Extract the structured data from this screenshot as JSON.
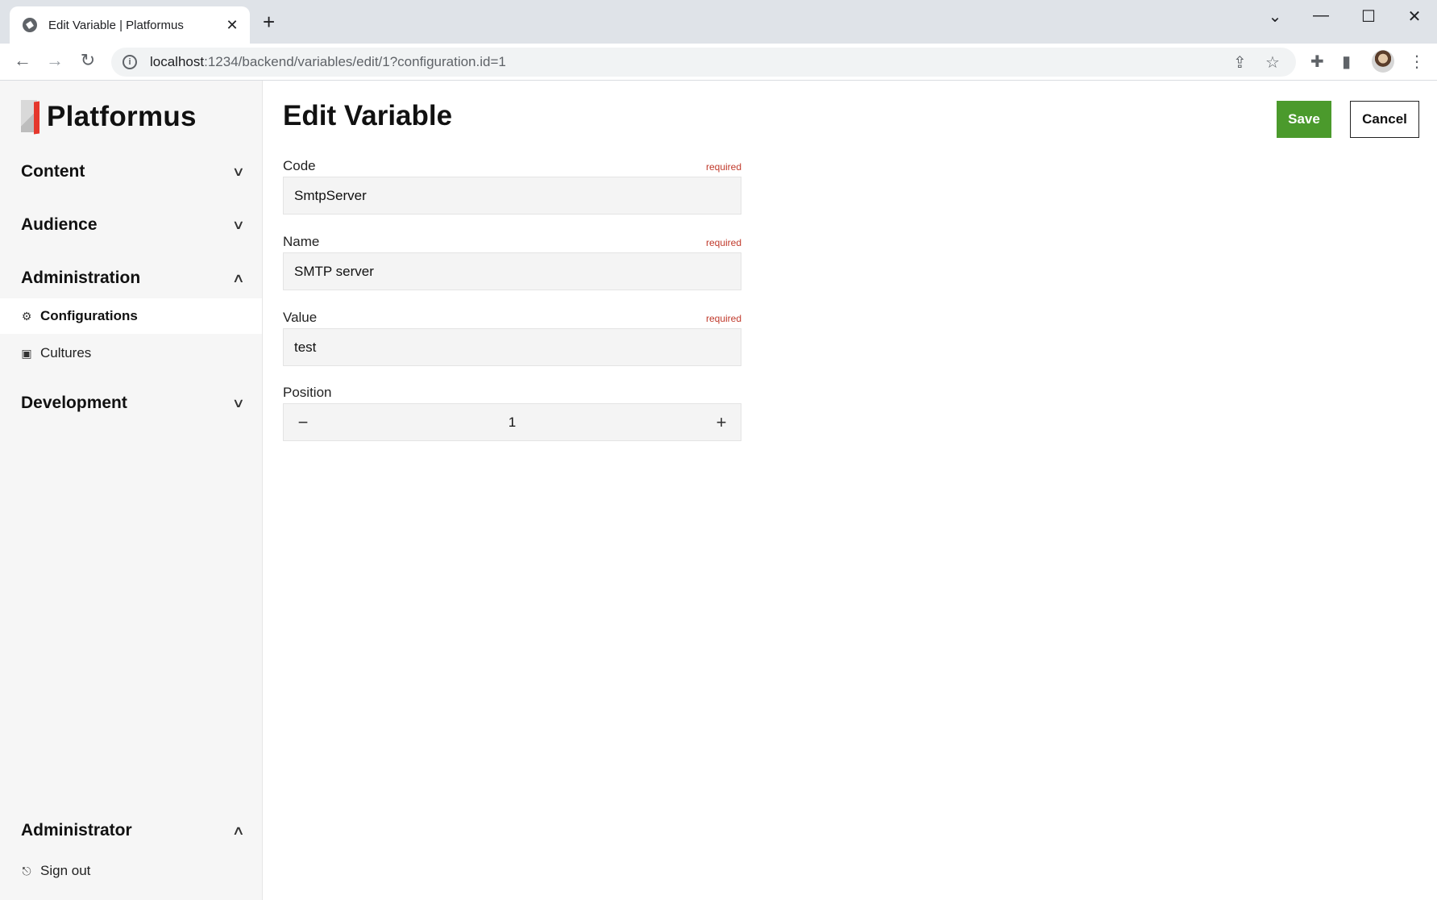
{
  "browser": {
    "tab_title": "Edit Variable | Platformus",
    "url_host": "localhost",
    "url_rest": ":1234/backend/variables/edit/1?configuration.id=1"
  },
  "sidebar": {
    "brand": "Platformus",
    "groups": [
      {
        "label": "Content",
        "expanded": false
      },
      {
        "label": "Audience",
        "expanded": false
      },
      {
        "label": "Administration",
        "expanded": true
      },
      {
        "label": "Development",
        "expanded": false
      }
    ],
    "admin_items": [
      {
        "label": "Configurations",
        "icon": "gear-icon",
        "active": true
      },
      {
        "label": "Cultures",
        "icon": "culture-icon",
        "active": false
      }
    ],
    "user_group": {
      "label": "Administrator",
      "expanded": true
    },
    "sign_out": "Sign out"
  },
  "main": {
    "title": "Edit Variable",
    "save_label": "Save",
    "cancel_label": "Cancel",
    "required_text": "required",
    "fields": {
      "code": {
        "label": "Code",
        "value": "SmtpServer",
        "required": true
      },
      "name": {
        "label": "Name",
        "value": "SMTP server",
        "required": true
      },
      "value": {
        "label": "Value",
        "value": "test",
        "required": true
      },
      "position": {
        "label": "Position",
        "value": "1",
        "required": false
      }
    }
  },
  "colors": {
    "accent_save": "#4b9a2c",
    "required": "#c0392b",
    "logo_red": "#e5372c"
  }
}
